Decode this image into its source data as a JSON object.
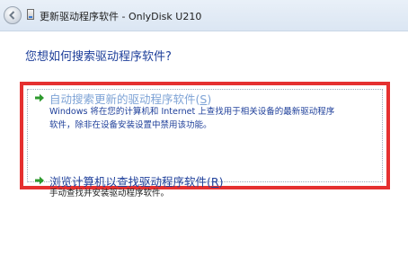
{
  "window": {
    "title": "更新驱动程序软件 - OnlyDisk U210"
  },
  "main": {
    "question": "您想如何搜索驱动程序软件?",
    "options": [
      {
        "title_prefix": "自动搜索更新的驱动程序软件(",
        "title_key": "S",
        "title_suffix": ")",
        "desc_line1": "Windows 将在您的计算机和 Internet 上查找用于相关设备的最新驱动程序",
        "desc_line2": "软件，除非在设备安装设置中禁用该功能。"
      },
      {
        "title_prefix": "浏览计算机以查找驱动程序软件(",
        "title_key": "R",
        "title_suffix": ")",
        "desc_line1": "手动查找并安装驱动程序软件。"
      }
    ]
  },
  "colors": {
    "highlight_border": "#e53030",
    "link_blue": "#1e3f9a",
    "arrow_green": "#2e9a2e"
  },
  "icons": {
    "back": "back-arrow-icon",
    "device": "device-icon",
    "option_arrow": "green-arrow-icon"
  }
}
